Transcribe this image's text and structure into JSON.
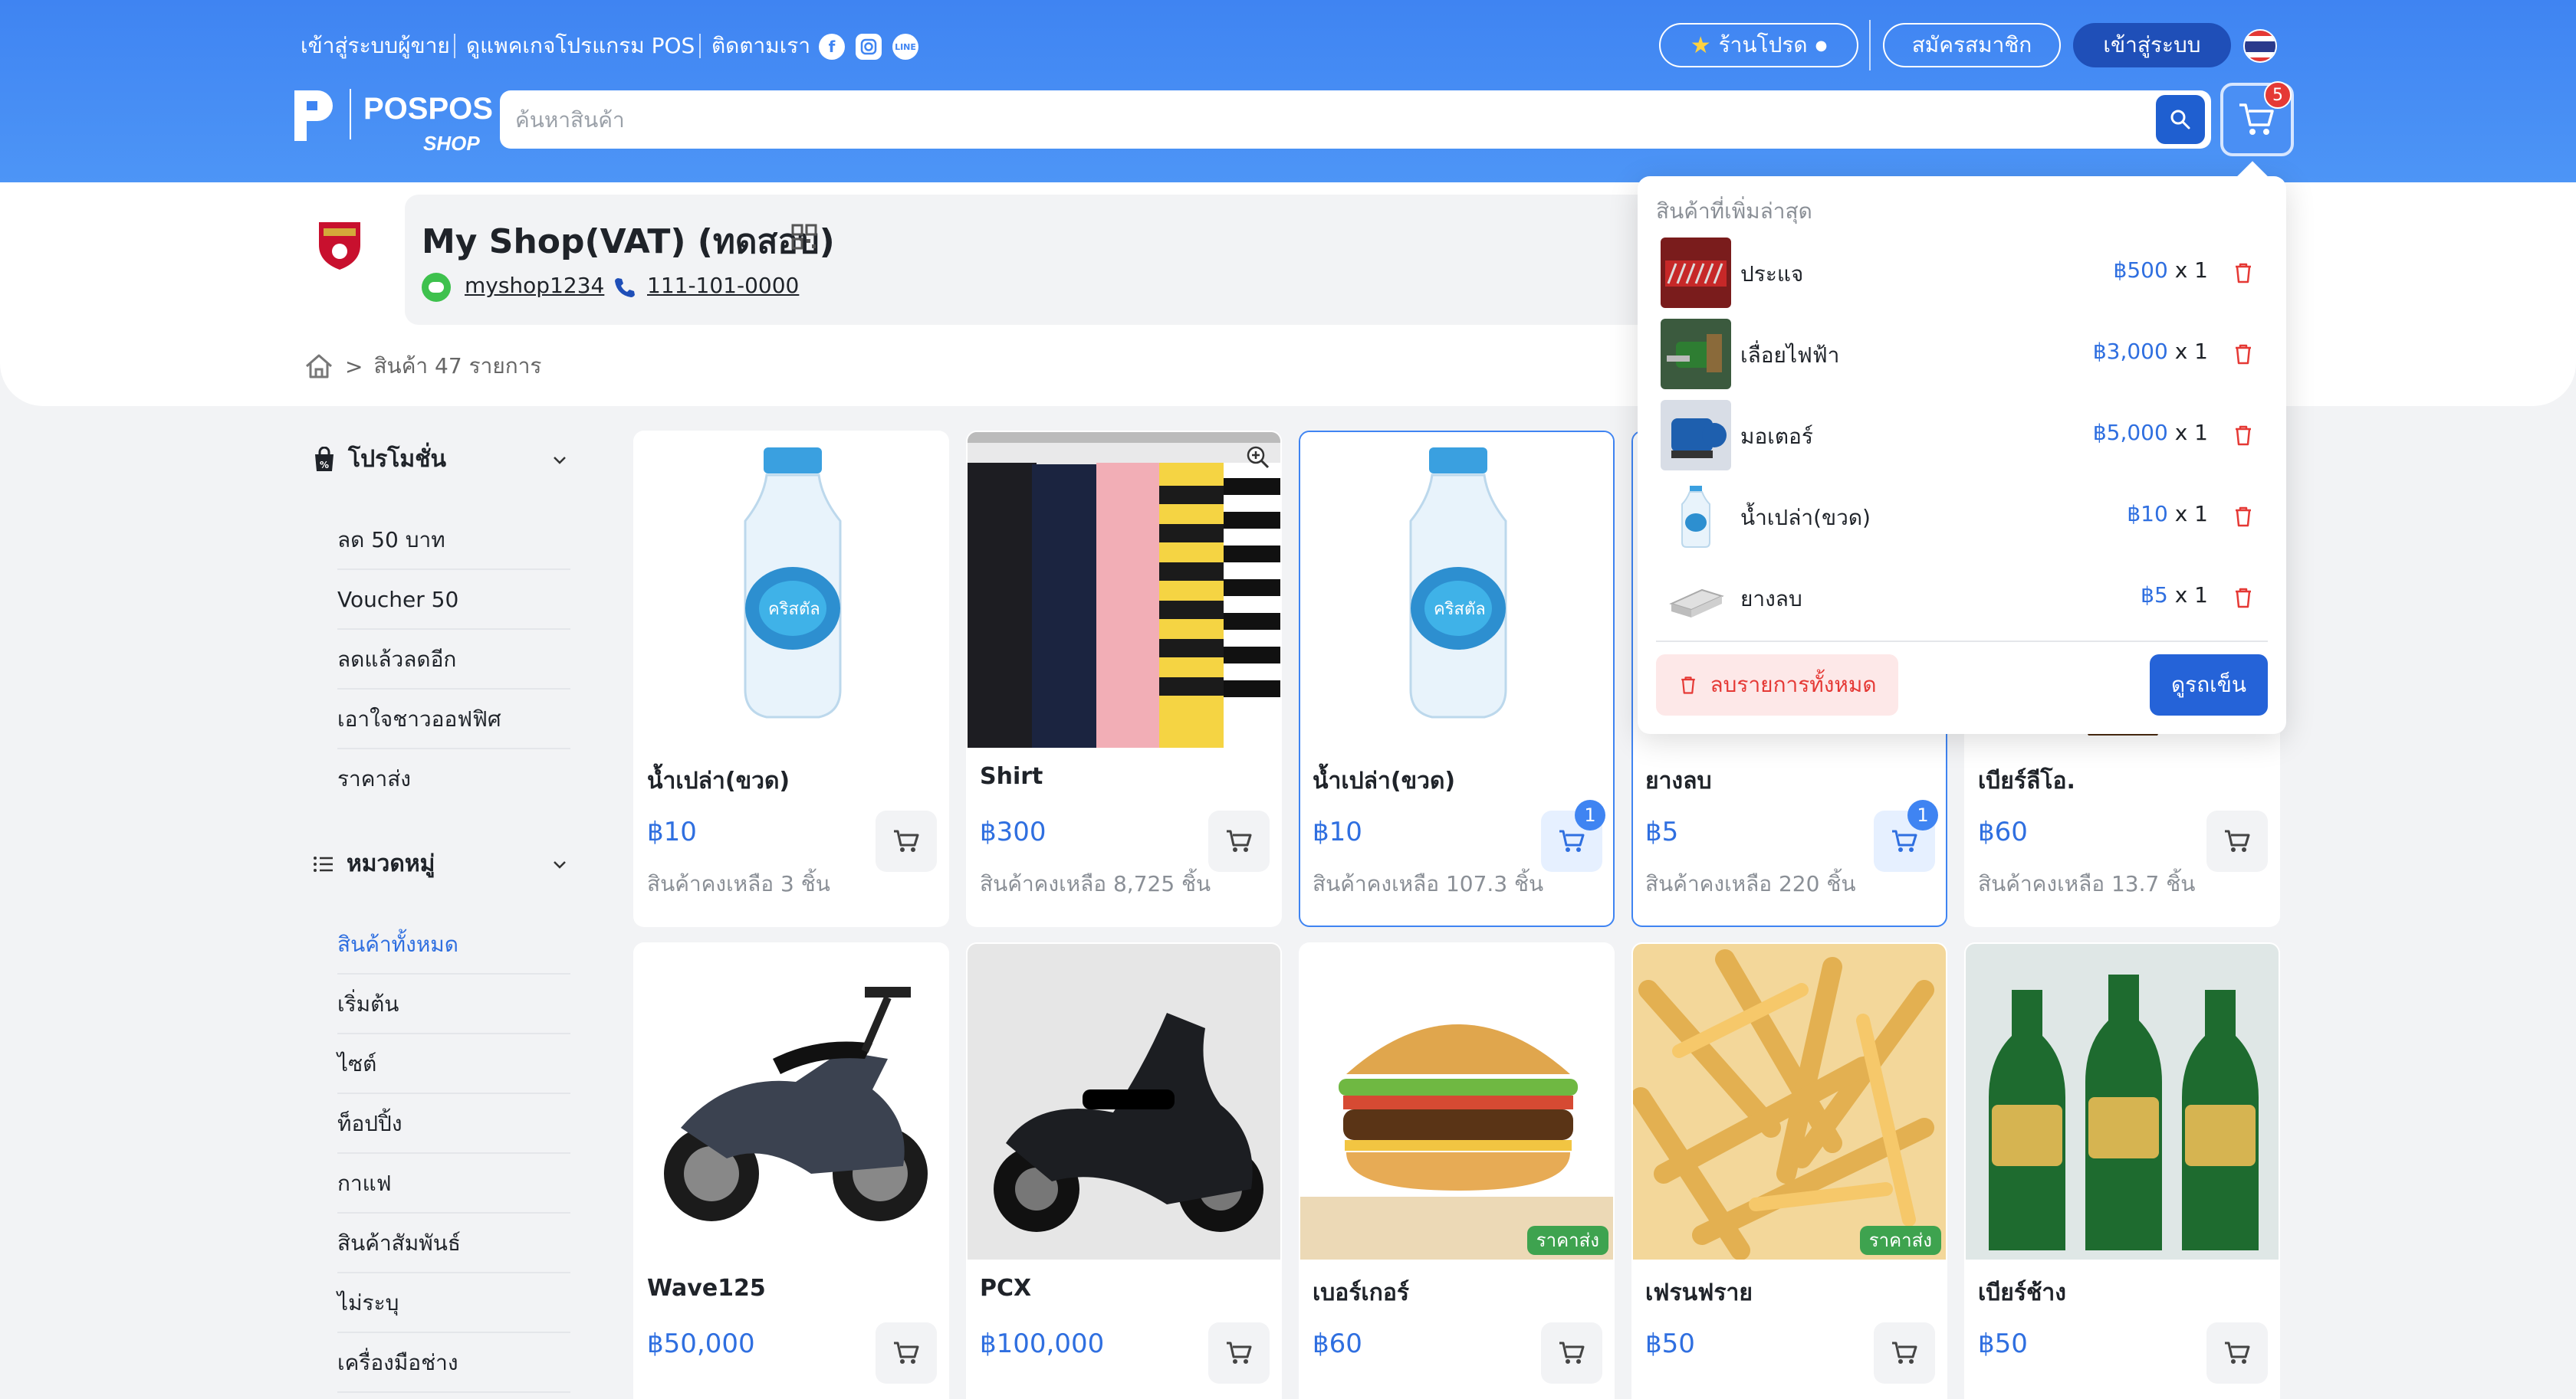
{
  "topbar": {
    "seller_login": "เข้าสู่ระบบผู้ขาย",
    "pos_packages": "ดูแพคเกจโปรแกรม POS",
    "follow_us": "ติดตามเรา",
    "social_icons": [
      "facebook-icon",
      "instagram-icon",
      "line-icon"
    ],
    "fav_shop": "ร้านโปรด",
    "register": "สมัครสมาชิก",
    "login": "เข้าสู่ระบบ",
    "language_flag": "thai-flag-icon"
  },
  "brand": {
    "name": "POSPOS",
    "sub": "SHOP"
  },
  "search": {
    "placeholder": "ค้นหาสินค้า"
  },
  "cart": {
    "count": "5"
  },
  "shop": {
    "name": "My Shop(VAT) (ทดสอบ)",
    "line_id": "myshop1234",
    "phone": "111-101-0000"
  },
  "breadcrumb": {
    "sep": ">",
    "label": "สินค้า 47 รายการ"
  },
  "sidebar": {
    "promotions_title": "โปรโมชั่น",
    "promotions": [
      "ลด 50 บาท",
      "Voucher 50",
      "ลดแล้วลดอีก",
      "เอาใจชาวออฟฟิศ",
      "ราคาส่ง"
    ],
    "categories_title": "หมวดหมู่",
    "categories": [
      "สินค้าทั้งหมด",
      "เริ่มต้น",
      "ไซต์",
      "ท็อปปิ้ง",
      "กาแฟ",
      "สินค้าสัมพันธ์",
      "ไม่ระบุ",
      "เครื่องมือช่าง"
    ],
    "active_category": "สินค้าทั้งหมด"
  },
  "products": [
    {
      "name": "น้ำเปล่า(ขวด)",
      "price": "฿10",
      "stock": "สินค้าคงเหลือ 3 ชิ้น",
      "img": "water"
    },
    {
      "name": "Shirt",
      "price": "฿300",
      "stock": "สินค้าคงเหลือ 8,725 ชิ้น",
      "img": "shirts"
    },
    {
      "name": "น้ำเปล่า(ขวด)",
      "price": "฿10",
      "stock": "สินค้าคงเหลือ 107.3 ชิ้น",
      "img": "water",
      "in_cart": "1"
    },
    {
      "name": "ยางลบ",
      "price": "฿5",
      "stock": "สินค้าคงเหลือ 220 ชิ้น",
      "img": "eraser",
      "in_cart": "1"
    },
    {
      "name": "เบียร์ลีโอ.",
      "price": "฿60",
      "stock": "สินค้าคงเหลือ 13.7 ชิ้น",
      "img": "beer"
    },
    {
      "name": "Wave125",
      "price": "฿50,000",
      "stock": "",
      "img": "moto"
    },
    {
      "name": "PCX",
      "price": "฿100,000",
      "stock": "",
      "img": "scooter"
    },
    {
      "name": "เบอร์เกอร์",
      "price": "฿60",
      "stock": "",
      "img": "burger",
      "tag": "ราคาส่ง"
    },
    {
      "name": "เฟรนฟราย",
      "price": "฿50",
      "stock": "",
      "img": "fries",
      "tag": "ราคาส่ง"
    },
    {
      "name": "เบียร์ช้าง",
      "price": "฿50",
      "stock": "",
      "img": "chang"
    }
  ],
  "cart_dropdown": {
    "title": "สินค้าที่เพิ่มล่าสุด",
    "items": [
      {
        "name": "ประแจ",
        "price": "฿500",
        "qty": "x 1"
      },
      {
        "name": "เลื่อยไฟฟ้า",
        "price": "฿3,000",
        "qty": "x 1"
      },
      {
        "name": "มอเตอร์",
        "price": "฿5,000",
        "qty": "x 1"
      },
      {
        "name": "น้ำเปล่า(ขวด)",
        "price": "฿10",
        "qty": "x 1"
      },
      {
        "name": "ยางลบ",
        "price": "฿5",
        "qty": "x 1"
      }
    ],
    "clear_all": "ลบรายการทั้งหมด",
    "view_cart": "ดูรถเข็น"
  },
  "colors": {
    "header_blue": "#3f84f2",
    "accent": "#2f6fe0",
    "danger": "#e53935",
    "wholesale_tag": "#3ea34f"
  }
}
